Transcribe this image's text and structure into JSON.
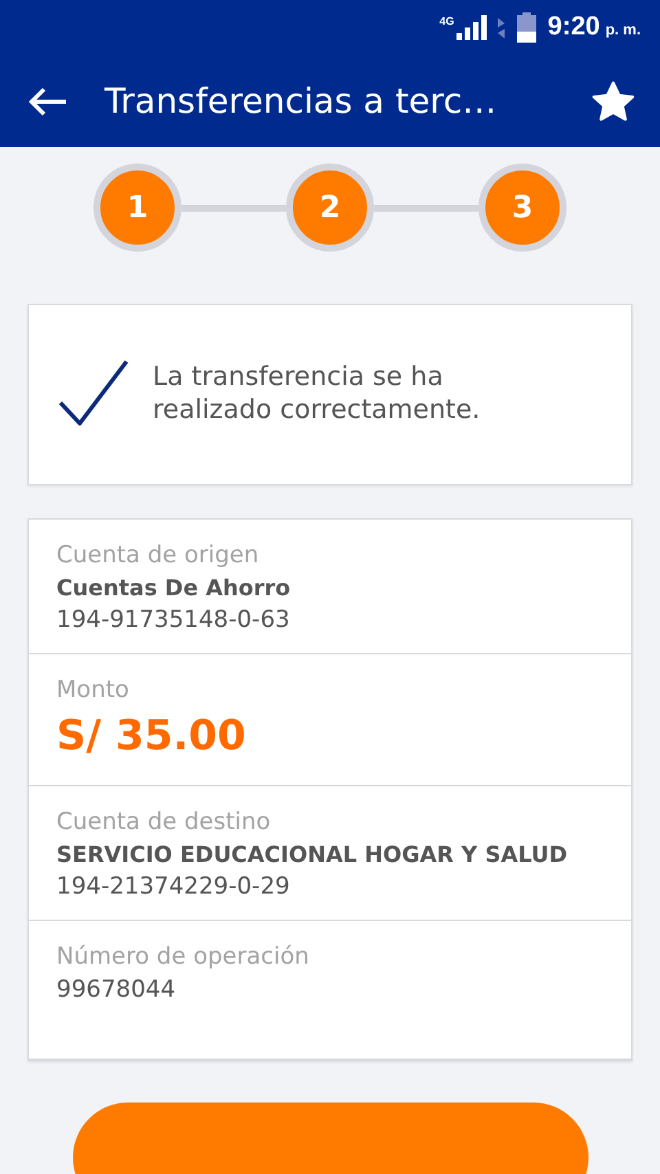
{
  "status_bar": {
    "network": "4G",
    "time": "9:20",
    "meridiem": "p. m."
  },
  "app_bar": {
    "title": "Transferencias a terc…",
    "favorite": true
  },
  "steps": [
    {
      "label": "1",
      "completed": true
    },
    {
      "label": "2",
      "completed": true
    },
    {
      "label": "3",
      "completed": true
    }
  ],
  "result": {
    "message": "La transferencia se ha realizado correctamente."
  },
  "details": [
    {
      "kind": "account",
      "label": "Cuenta de origen",
      "name": "Cuentas De Ahorro",
      "number": "194-91735148-0-63"
    },
    {
      "kind": "amount",
      "label": "Monto",
      "value": "S/ 35.00"
    },
    {
      "kind": "account",
      "label": "Cuenta de destino",
      "name": "SERVICIO EDUCACIONAL HOGAR Y SALUD",
      "number": "194-21374229-0-29"
    },
    {
      "kind": "plain",
      "label": "Número de operación",
      "value": "99678044"
    }
  ],
  "primary_button": {
    "kind": "button"
  }
}
